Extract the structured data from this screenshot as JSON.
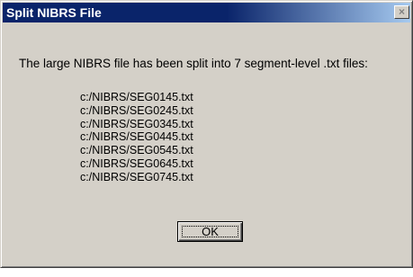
{
  "window": {
    "title": "Split NIBRS File",
    "close_symbol": "×"
  },
  "message": "The large NIBRS file has been split into 7 segment-level .txt files:",
  "files": [
    "c:/NIBRS/SEG0145.txt",
    "c:/NIBRS/SEG0245.txt",
    "c:/NIBRS/SEG0345.txt",
    "c:/NIBRS/SEG0445.txt",
    "c:/NIBRS/SEG0545.txt",
    "c:/NIBRS/SEG0645.txt",
    "c:/NIBRS/SEG0745.txt"
  ],
  "buttons": {
    "ok_label": "OK"
  },
  "colors": {
    "titlebar_start": "#0a246a",
    "titlebar_end": "#a6caf0",
    "dialog_face": "#d4d0c8"
  },
  "icons": {
    "close": "close-icon"
  }
}
